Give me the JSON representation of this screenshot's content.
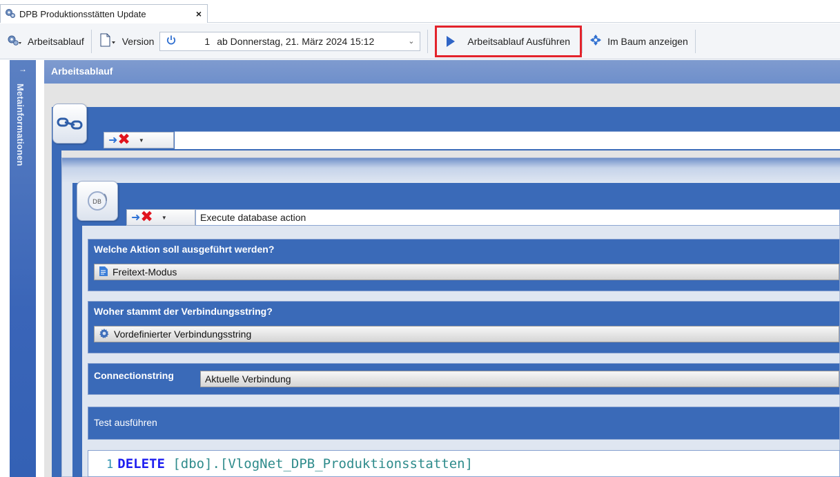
{
  "tab": {
    "title": "DPB Produktionsstätten Update",
    "close": "×"
  },
  "toolbar": {
    "workflow_label": "Arbeitsablauf",
    "version_label": "Version",
    "version_number": "1",
    "version_text": "ab Donnerstag, 21. März 2024 15:12",
    "run_label": "Arbeitsablauf Ausführen",
    "tree_label": "Im Baum anzeigen"
  },
  "sidebar": {
    "arrow": "→",
    "label": "Metainformationen"
  },
  "panel": {
    "header": "Arbeitsablauf"
  },
  "inner": {
    "action_name": "Execute database action"
  },
  "groups": {
    "action": {
      "title": "Welche Aktion soll ausgeführt werden?",
      "value": "Freitext-Modus"
    },
    "connection_source": {
      "title": "Woher stammt der Verbindungsstring?",
      "value": "Vordefinierter Verbindungsstring"
    },
    "connection_string": {
      "label": "Connectionstring",
      "value": "Aktuelle Verbindung"
    },
    "test": {
      "label": "Test ausführen"
    }
  },
  "code": {
    "line_number": "1",
    "keyword": "DELETE",
    "rest": "[dbo].[VlogNet_DPB_Produktionsstatten]"
  },
  "colors": {
    "accent": "#3a6ab8",
    "highlight_border": "#e3232b",
    "x_red": "#e1141e"
  }
}
